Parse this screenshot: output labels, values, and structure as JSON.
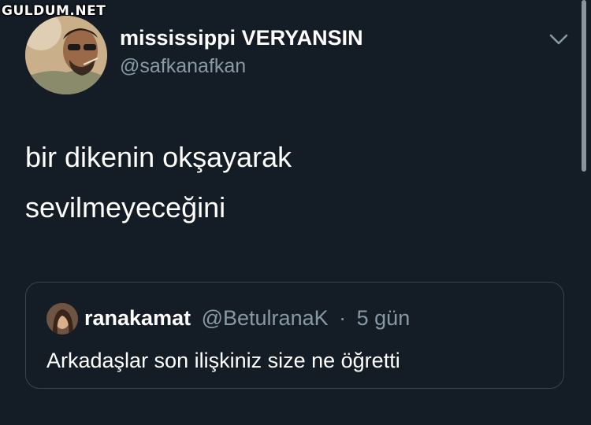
{
  "watermark": {
    "text": "GULDUM.NET"
  },
  "tweet": {
    "author_name": "mississippi VERYANSIN",
    "author_handle": "@safkanafkan",
    "text_line1": "bir dikenin okşayarak",
    "text_line2": "sevilmeyeceğini",
    "menu_icon": "chevron-down-icon"
  },
  "quoted_tweet": {
    "author_name": "ranakamat",
    "author_handle": "@BetulranaK",
    "separator": "·",
    "time": "5 gün",
    "text": "Arkadaşlar son ilişkiniz size ne öğretti"
  },
  "colors": {
    "background": "#141d26",
    "text_primary": "#ffffff",
    "text_secondary": "#8899a6",
    "border": "#38444d"
  }
}
